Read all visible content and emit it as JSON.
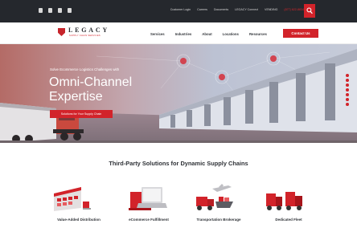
{
  "topbar": {
    "social_icons": [
      "twitter-icon",
      "facebook-icon",
      "linkedin-icon",
      "youtube-icon"
    ],
    "links": [
      "Customer Login",
      "Careers",
      "Documents",
      "LEGACY Connect",
      "VENDING"
    ],
    "phone": "(877) 622-8834",
    "search_icon": "search-icon"
  },
  "brand": {
    "name": "LEGACY",
    "tagline": "SUPPLY CHAIN SERVICES"
  },
  "nav": {
    "items": [
      "Services",
      "Industries",
      "About",
      "Locations",
      "Resources"
    ],
    "contact_label": "Contact Us"
  },
  "hero": {
    "eyebrow": "Solve Ecommerce Logistics Challenges with",
    "title_line1": "Omni-Channel",
    "title_line2": "Expertise",
    "cta_label": "Solutions for Your Supply Chain"
  },
  "services": {
    "heading": "Third-Party Solutions for Dynamic Supply Chains",
    "items": [
      {
        "label": "Value-Added Distribution",
        "icon": "warehouse-icon"
      },
      {
        "label": "eCommerce Fulfillment",
        "icon": "laptop-box-icon"
      },
      {
        "label": "Transportation Brokerage",
        "icon": "truck-plane-ship-icon"
      },
      {
        "label": "Dedicated Fleet",
        "icon": "trucks-icon"
      }
    ]
  },
  "colors": {
    "accent": "#d2232a",
    "topbar": "#25282d"
  }
}
